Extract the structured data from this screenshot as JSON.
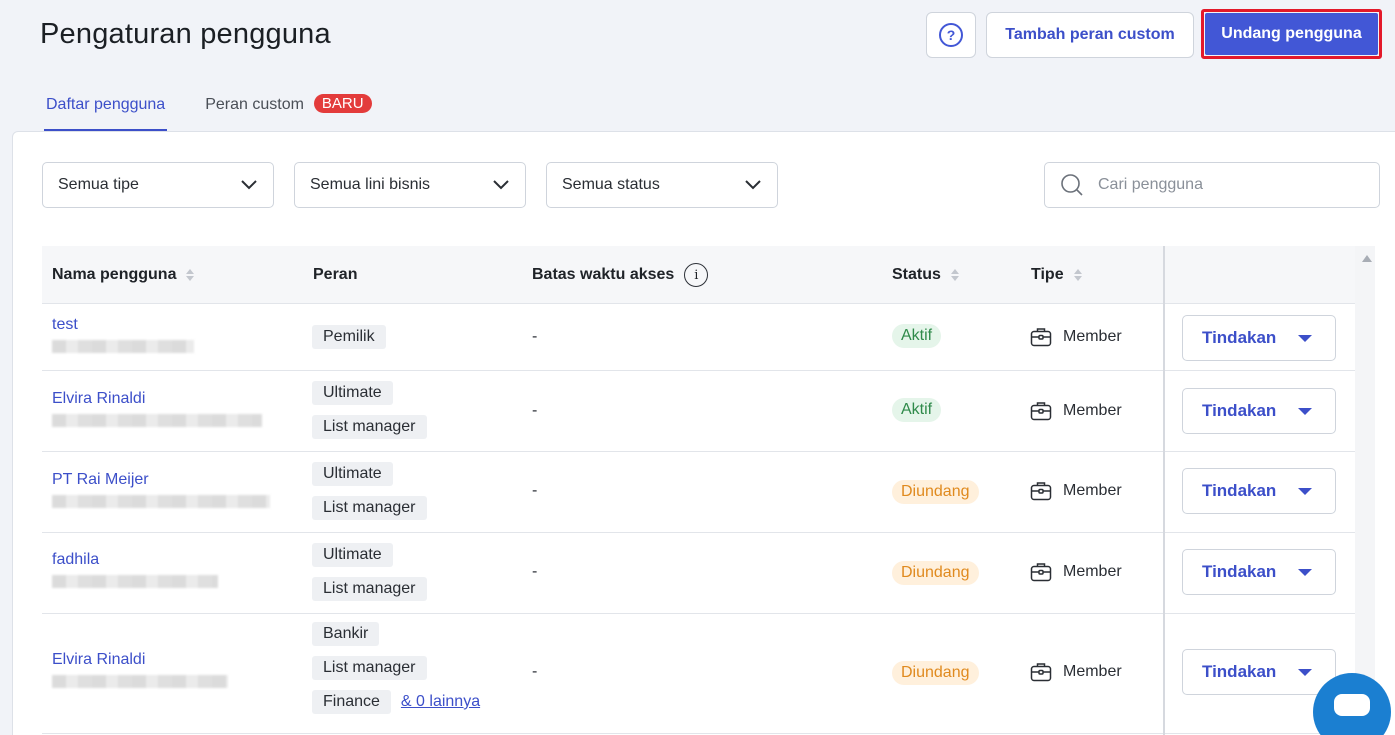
{
  "header": {
    "title": "Pengaturan pengguna",
    "help_icon_label": "?",
    "add_custom_role_label": "Tambah peran custom",
    "invite_user_label": "Undang pengguna"
  },
  "tabs": [
    {
      "label": "Daftar pengguna",
      "active": true
    },
    {
      "label": "Peran custom",
      "badge": "BARU",
      "active": false
    }
  ],
  "filters": {
    "type": "Semua tipe",
    "business_line": "Semua lini bisnis",
    "status": "Semua status",
    "search_placeholder": "Cari pengguna"
  },
  "table": {
    "columns": {
      "name": "Nama pengguna",
      "role": "Peran",
      "access_limit": "Batas waktu akses",
      "status": "Status",
      "type": "Tipe"
    },
    "info_icon_label": "i",
    "action_label": "Tindakan",
    "rows": [
      {
        "name": "test",
        "roles": [
          "Pemilik"
        ],
        "access": "-",
        "status": "Aktif",
        "type": "Member"
      },
      {
        "name": "Elvira Rinaldi",
        "roles": [
          "Ultimate",
          "List manager"
        ],
        "access": "-",
        "status": "Aktif",
        "type": "Member"
      },
      {
        "name": "PT Rai Meijer",
        "roles": [
          "Ultimate",
          "List manager"
        ],
        "access": "-",
        "status": "Diundang",
        "type": "Member"
      },
      {
        "name": "fadhila",
        "roles": [
          "Ultimate",
          "List manager"
        ],
        "access": "-",
        "status": "Diundang",
        "type": "Member"
      },
      {
        "name": "Elvira Rinaldi",
        "roles": [
          "Bankir",
          "List manager",
          "Finance"
        ],
        "more_roles": "& 0 lainnya",
        "access": "-",
        "status": "Diundang",
        "type": "Member"
      }
    ]
  },
  "colors": {
    "accent": "#4257d6",
    "highlight_border": "#e3192a",
    "badge_new": "#e33b3b",
    "status_active": "#2f8a4a",
    "status_invited": "#e08a1e"
  }
}
